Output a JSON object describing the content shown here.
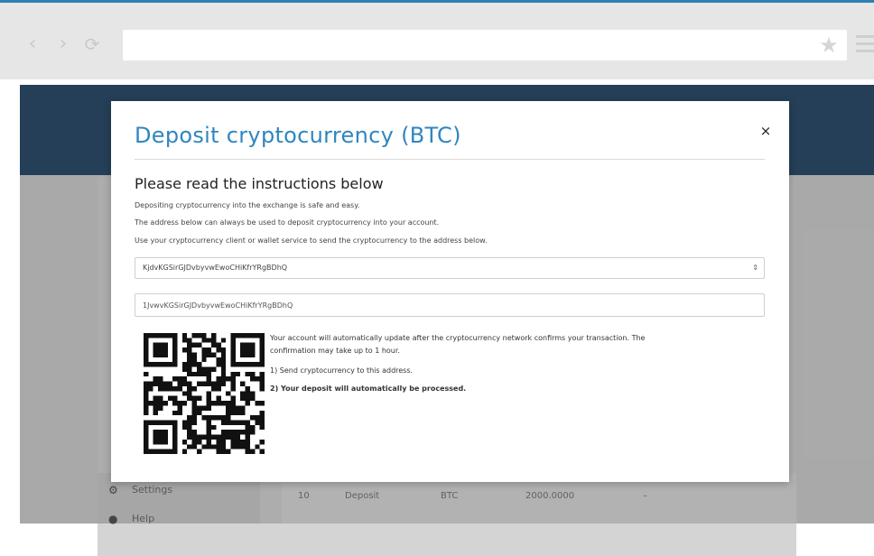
{
  "colors": {
    "accent": "#2f86bf",
    "header": "#2d4d6b",
    "browser_bar": "#e6e6e6"
  },
  "browser": {
    "back_icon": "‹",
    "forward_icon": "›",
    "reload_icon": "⟳",
    "star_icon": "★",
    "address": ""
  },
  "background_app": {
    "sidebar": [
      {
        "icon": "gear-icon",
        "glyph": "⚙",
        "label": "Settings"
      },
      {
        "icon": "help-icon",
        "glyph": "●",
        "label": "Help"
      }
    ],
    "table_row": {
      "id": "10",
      "type": "Deposit",
      "currency": "BTC",
      "amount": "2000.0000",
      "status": "–"
    }
  },
  "modal": {
    "title": "Deposit cryptocurrency (BTC)",
    "close_label": "×",
    "heading": "Please read the instructions below",
    "instructions": [
      "Depositing cryptocurrency into the exchange is safe and easy.",
      "The address below can always be used to deposit cryptocurrency into your account.",
      "Use your cryptocurrency client or wallet service to send the cryptocurrency to the address below."
    ],
    "address_select_value": "KjdvKGSirGJDvbyvwEwoCHiKfrYRgBDhQ",
    "address_input_value": "1JvwvKGSirGJDvbyvwEwoCHiKfrYRgBDhQ",
    "info": {
      "line1": "Your account will automatically update after the cryptocurrency network confirms your transaction. The",
      "line2": "confirmation may take up to 1 hour.",
      "step1": "1) Send cryptocurrency to this address.",
      "step2": "2) Your deposit will automatically be processed."
    }
  }
}
